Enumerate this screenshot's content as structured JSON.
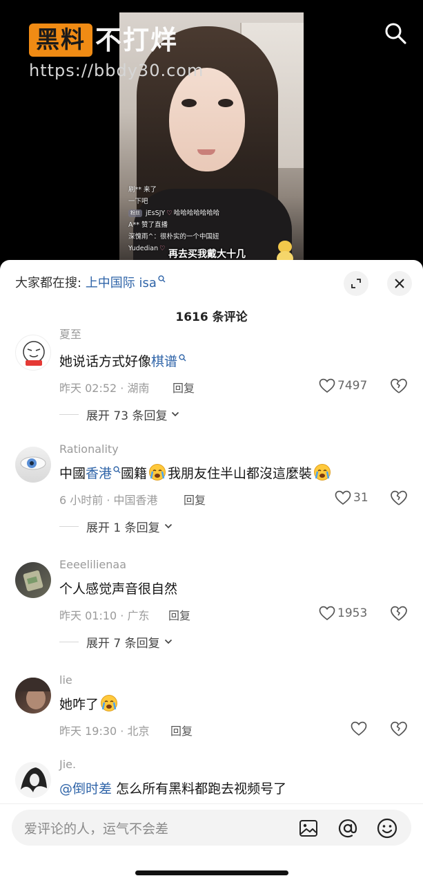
{
  "watermark": {
    "badge": "黑料",
    "text": "不打烊",
    "url": "https://bbdy30.com"
  },
  "video": {
    "live_comments": [
      {
        "text": "刷** 来了"
      },
      {
        "text": "一下吧"
      },
      {
        "tag": "粉丝",
        "user": "jEsSJY",
        "text": "哈哈哈哈哈哈哈"
      },
      {
        "text": "A** 赞了直播"
      },
      {
        "text": "深愧雨^：很朴实的一个中国妞"
      },
      {
        "text": "Yudedian"
      }
    ],
    "subtitle": "再去买我戴大十几"
  },
  "sheet": {
    "search_label": "大家都在搜:",
    "search_term": "上中国际 isa",
    "comment_count": "1616 条评论",
    "comments": [
      {
        "username": "夏至",
        "text_before": "她说话方式好像",
        "link": "棋谱",
        "meta": "昨天 02:52 · 湖南",
        "reply": "回复",
        "likes": "7497",
        "expand": "展开 73 条回复"
      },
      {
        "username": "Rationality",
        "text_before": "中國",
        "link": "香港",
        "text_middle": "國籍",
        "text_after": "我朋友住半山都沒這麼裝",
        "meta": "6 小时前 · 中国香港",
        "reply": "回复",
        "likes": "31",
        "expand": "展开 1 条回复"
      },
      {
        "username": "Eeeelilienaa",
        "text": "个人感觉声音很自然",
        "meta": "昨天 01:10 · 广东",
        "reply": "回复",
        "likes": "1953",
        "expand": "展开 7 条回复"
      },
      {
        "username": "lie",
        "text": "她咋了",
        "meta": "昨天 19:30 · 北京",
        "reply": "回复",
        "likes": ""
      },
      {
        "username": "Jie.",
        "mention": "@倒时差",
        "text": "怎么所有黑料都跑去视频号了"
      }
    ]
  },
  "input": {
    "placeholder": "爱评论的人，运气不会差"
  },
  "colors": {
    "link": "#2f64a8",
    "watermark_orange": "#f08b14"
  }
}
